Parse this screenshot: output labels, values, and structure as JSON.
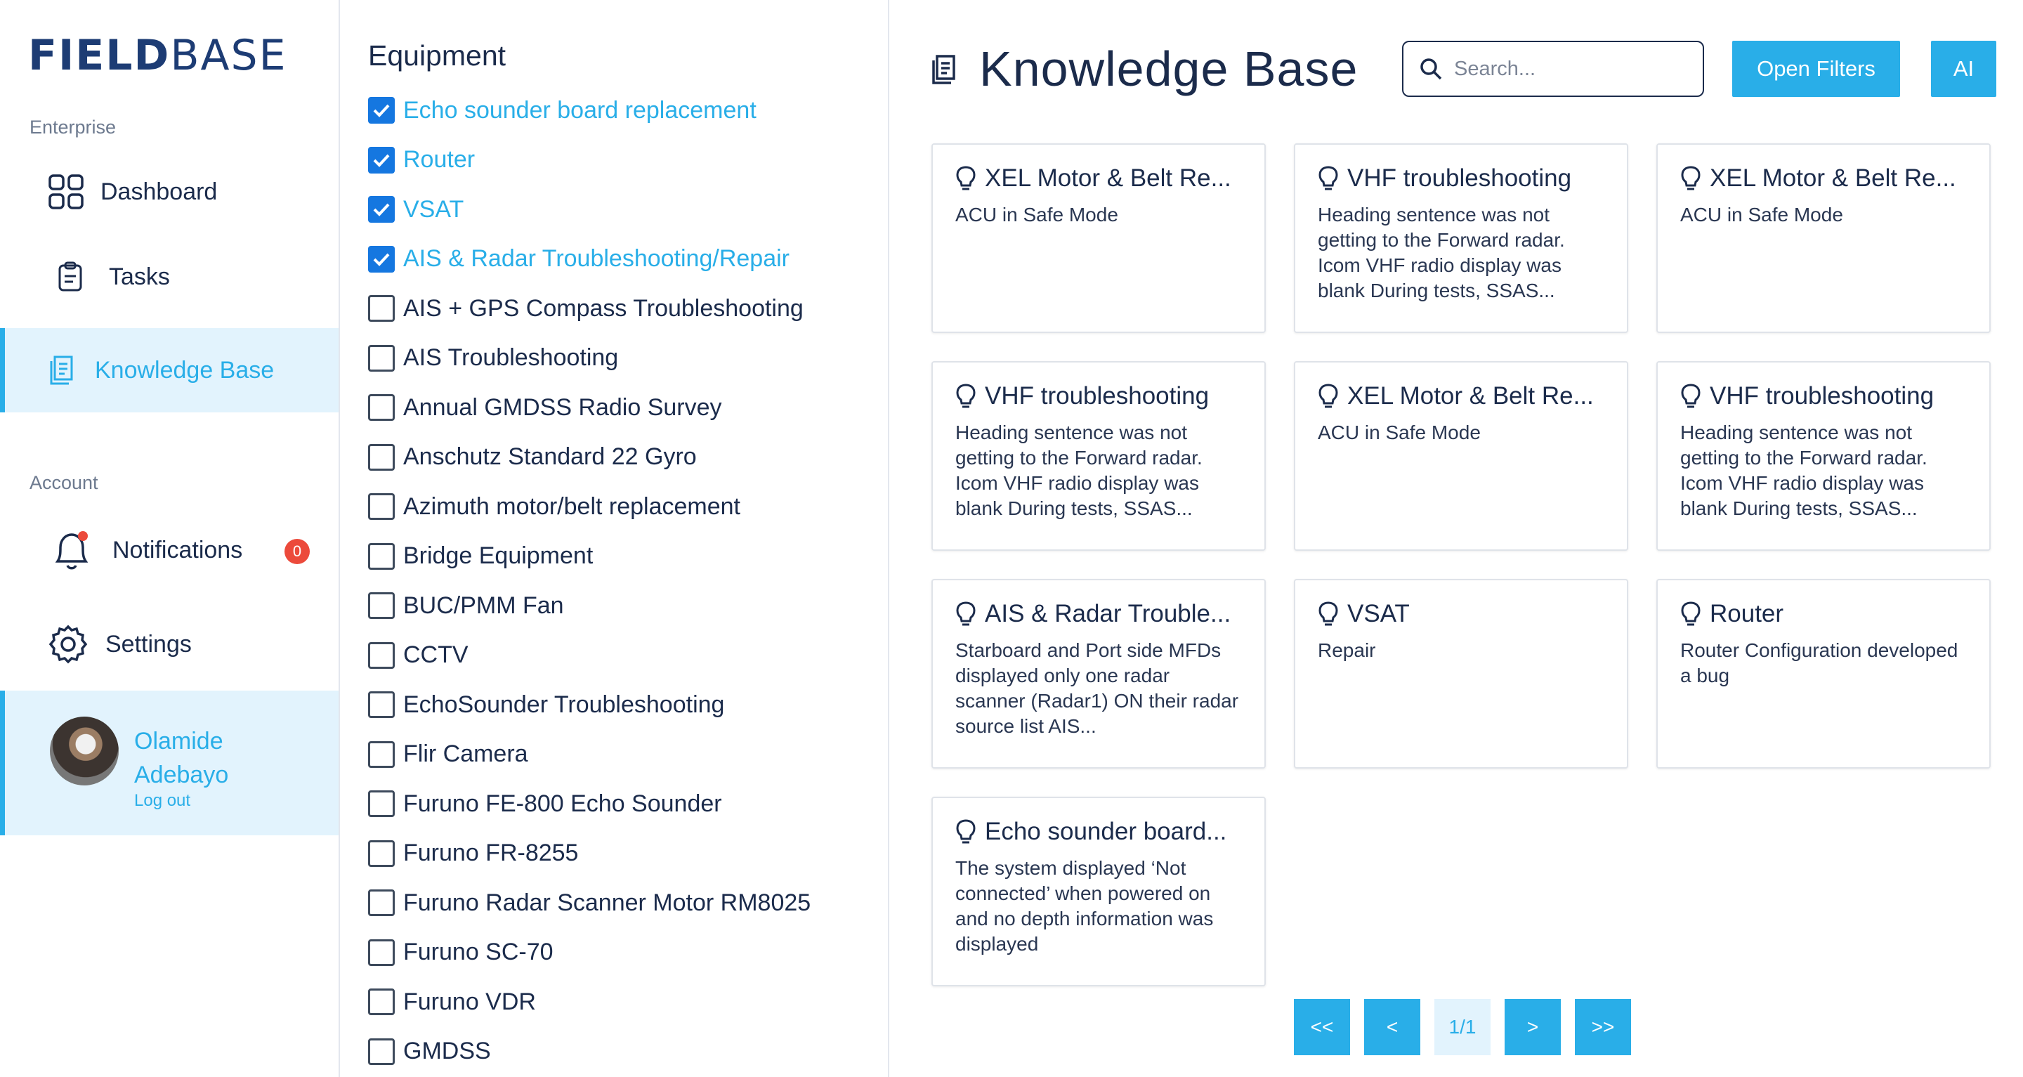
{
  "brand": {
    "logo_bold": "FIELD",
    "logo_light": "BASE"
  },
  "sidebar": {
    "section_enterprise": "Enterprise",
    "section_account": "Account",
    "items": [
      {
        "label": "Dashboard",
        "icon": "grid-icon"
      },
      {
        "label": "Tasks",
        "icon": "clipboard-icon"
      },
      {
        "label": "Knowledge Base",
        "icon": "document-icon",
        "active": true
      },
      {
        "label": "Notifications",
        "icon": "bell-icon",
        "badge": "0"
      },
      {
        "label": "Settings",
        "icon": "gear-icon"
      }
    ],
    "user": {
      "name": "Olamide Adebayo",
      "logout": "Log out"
    }
  },
  "filters": {
    "title": "Equipment",
    "items": [
      {
        "label": "Echo sounder board replacement",
        "checked": true
      },
      {
        "label": "Router",
        "checked": true
      },
      {
        "label": "VSAT",
        "checked": true
      },
      {
        "label": "AIS & Radar Troubleshooting/Repair",
        "checked": true
      },
      {
        "label": "AIS + GPS Compass Troubleshooting",
        "checked": false
      },
      {
        "label": "AIS Troubleshooting",
        "checked": false
      },
      {
        "label": "Annual GMDSS Radio Survey",
        "checked": false
      },
      {
        "label": "Anschutz Standard 22 Gyro",
        "checked": false
      },
      {
        "label": "Azimuth motor/belt replacement",
        "checked": false
      },
      {
        "label": "Bridge Equipment",
        "checked": false
      },
      {
        "label": "BUC/PMM Fan",
        "checked": false
      },
      {
        "label": "CCTV",
        "checked": false
      },
      {
        "label": "EchoSounder Troubleshooting",
        "checked": false
      },
      {
        "label": "Flir Camera",
        "checked": false
      },
      {
        "label": "Furuno FE-800 Echo Sounder",
        "checked": false
      },
      {
        "label": "Furuno FR-8255",
        "checked": false
      },
      {
        "label": "Furuno Radar Scanner Motor RM8025",
        "checked": false
      },
      {
        "label": "Furuno SC-70",
        "checked": false
      },
      {
        "label": "Furuno VDR",
        "checked": false
      },
      {
        "label": "GMDSS",
        "checked": false
      }
    ]
  },
  "main": {
    "title": "Knowledge Base",
    "search_placeholder": "Search...",
    "open_filters": "Open Filters",
    "ai": "AI",
    "cards": [
      {
        "title": "XEL Motor & Belt Re...",
        "desc": "ACU in Safe Mode"
      },
      {
        "title": "VHF troubleshooting",
        "desc": "Heading sentence was not getting to the Forward radar. Icom VHF radio display was blank During tests, SSAS..."
      },
      {
        "title": "XEL Motor & Belt Re...",
        "desc": "ACU in Safe Mode"
      },
      {
        "title": "VHF troubleshooting",
        "desc": "Heading sentence was not getting to the Forward radar. Icom VHF radio display was blank During tests, SSAS..."
      },
      {
        "title": "XEL Motor & Belt Re...",
        "desc": "ACU in Safe Mode"
      },
      {
        "title": "VHF troubleshooting",
        "desc": "Heading sentence was not getting to the Forward radar. Icom VHF radio display was blank During tests, SSAS..."
      },
      {
        "title": "AIS & Radar Trouble...",
        "desc": "Starboard and Port side MFDs displayed only one radar scanner (Radar1) ON their radar source list AIS..."
      },
      {
        "title": "VSAT",
        "desc": "Repair"
      },
      {
        "title": "Router",
        "desc": "Router Configuration developed a bug"
      },
      {
        "title": "Echo sounder board...",
        "desc": "The system displayed ‘Not connected’ when powered on and no depth information was displayed"
      }
    ],
    "pagination": {
      "first": "<<",
      "prev": "<",
      "page": "1/1",
      "next": ">",
      "last": ">>"
    }
  },
  "colors": {
    "accent": "#29aee8",
    "checkbox": "#1577e0",
    "text": "#1b2b4b",
    "badge": "#ec4a3b",
    "active_bg": "#e2f3fd"
  }
}
